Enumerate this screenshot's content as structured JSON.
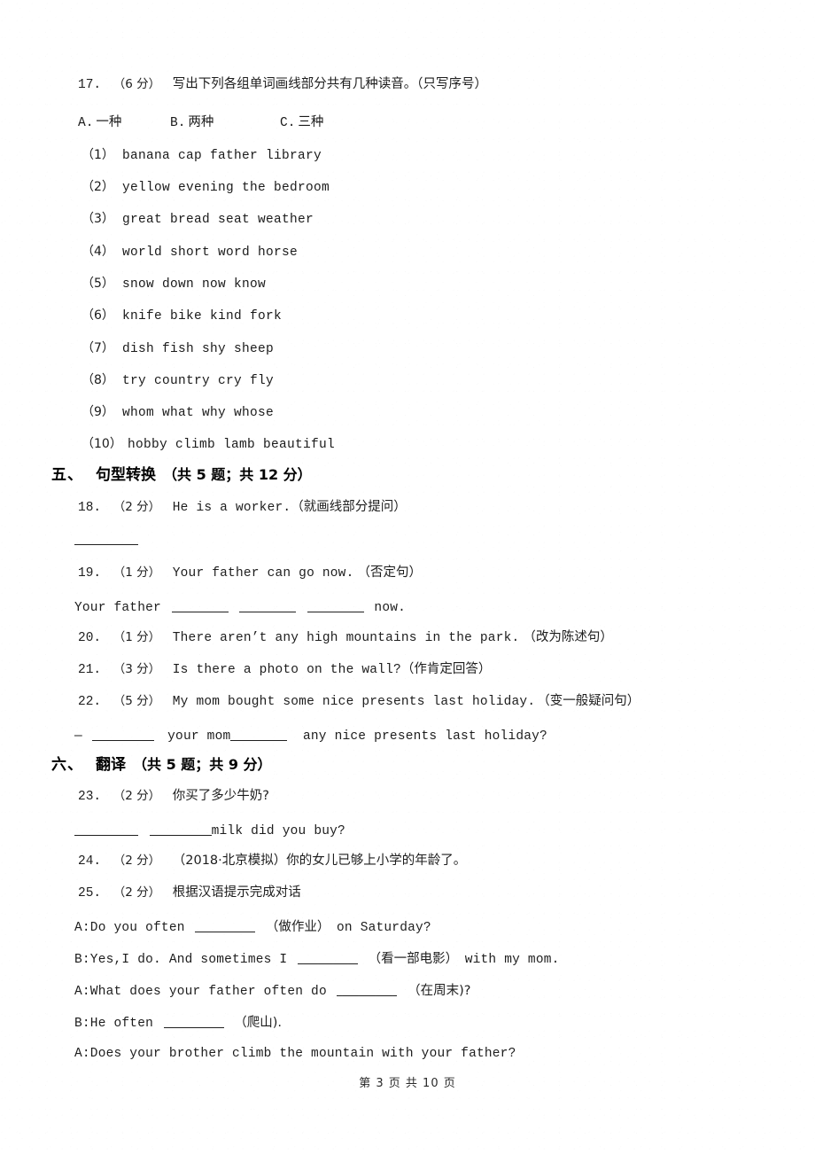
{
  "page": {
    "footer": "第 3 页 共 10 页",
    "page_number": "3",
    "total_pages": "10"
  },
  "q17": {
    "number": "17.",
    "score": "（6 分）",
    "prompt": "写出下列各组单词画线部分共有几种读音。（只写序号）",
    "options": [
      {
        "key": "A.",
        "label": "一种"
      },
      {
        "key": "B.",
        "label": "两种"
      },
      {
        "key": "C.",
        "label": "三种"
      }
    ],
    "groups": [
      {
        "index": "（1）",
        "words": "banana      cap      father library"
      },
      {
        "index": "（2）",
        "words": "yellow      evening the      bedroom"
      },
      {
        "index": "（3）",
        "words": "great       bread      seat      weather"
      },
      {
        "index": "（4）",
        "words": "world       short      word horse"
      },
      {
        "index": "（5）",
        "words": "snow        down      now      know"
      },
      {
        "index": "（6）",
        "words": "knife      bike      kind      fork"
      },
      {
        "index": "（7）",
        "words": "dish      fish      shy     sheep"
      },
      {
        "index": "（8）",
        "words": "try      country      cry      fly"
      },
      {
        "index": "（9）",
        "words": "whom      what      why      whose"
      },
      {
        "index": "（10）",
        "words": "hobby      climb     lamb      beautiful"
      }
    ]
  },
  "section5": {
    "num": "五、",
    "title": "句型转换",
    "meta": "（共 5 题；共 12 分）",
    "q18": {
      "number": "18.",
      "score": "（2 分）",
      "text": "He is a worker.",
      "hint": "（就画线部分提问）"
    },
    "q19": {
      "number": "19.",
      "score": "（1 分）",
      "text": "Your father can go now.",
      "hint": "（否定句）",
      "answer_prefix": "Your father",
      "answer_suffix": "now."
    },
    "q20": {
      "number": "20.",
      "score": "（1 分）",
      "text": "There aren’t any high mountains in the park.",
      "hint": "（改为陈述句）"
    },
    "q21": {
      "number": "21.",
      "score": "（3 分）",
      "text": "Is there a photo on the wall?",
      "hint": "（作肯定回答）"
    },
    "q22": {
      "number": "22.",
      "score": "（5 分）",
      "text": "My mom bought some nice presents last holiday.",
      "hint": "（变一般疑问句）",
      "answer_dash": "—",
      "answer_mid": "your mom",
      "answer_tail": "any nice presents last holiday?"
    }
  },
  "section6": {
    "num": "六、",
    "title": "翻译",
    "meta": "（共 5 题；共 9 分）",
    "q23": {
      "number": "23.",
      "score": "（2 分）",
      "text": "你买了多少牛奶?",
      "answer_tail": "milk did you buy?"
    },
    "q24": {
      "number": "24.",
      "score": "（2 分）",
      "source": "（2018·北京模拟）",
      "text": "你的女儿已够上小学的年龄了。"
    },
    "q25": {
      "number": "25.",
      "score": "（2 分）",
      "text": "根据汉语提示完成对话",
      "dialogue": [
        {
          "pre": "A:Do you often",
          "hint": "（做作业）",
          "post": "on Saturday?"
        },
        {
          "pre": "B:Yes,I do. And sometimes I",
          "hint": "（看一部电影）",
          "post": "with my mom."
        },
        {
          "pre": "A:What does your father often do",
          "hint": "（在周末)?",
          "post": ""
        },
        {
          "pre": "B:He often",
          "hint": "（爬山).",
          "post": ""
        },
        {
          "pre": "A:Does your brother climb the mountain with your father?",
          "hint": "",
          "post": ""
        }
      ]
    }
  }
}
